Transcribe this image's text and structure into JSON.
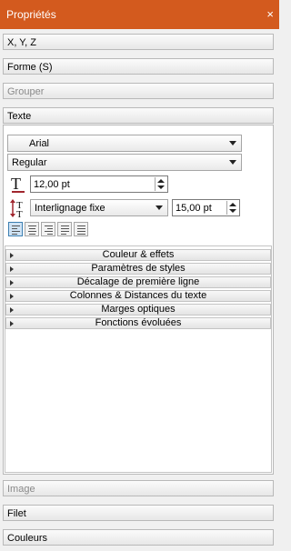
{
  "window": {
    "title": "Propriétés",
    "close_glyph": "×"
  },
  "sections_top": [
    {
      "label": "X, Y, Z",
      "disabled": false
    },
    {
      "label": "Forme (S)",
      "disabled": false
    },
    {
      "label": "Grouper",
      "disabled": true
    },
    {
      "label": "Texte",
      "disabled": false
    }
  ],
  "texte": {
    "font_family": "Arial",
    "font_style": "Regular",
    "font_size": "12,00 pt",
    "line_spacing_mode": "Interlignage fixe",
    "line_spacing_value": "15,00 pt",
    "alignment_active": "left",
    "subsections": [
      "Couleur & effets",
      "Paramètres de styles",
      "Décalage de première ligne",
      "Colonnes & Distances du texte",
      "Marges optiques",
      "Fonctions évoluées"
    ]
  },
  "sections_bottom": [
    {
      "label": "Image",
      "disabled": true
    },
    {
      "label": "Filet",
      "disabled": false
    },
    {
      "label": "Couleurs",
      "disabled": false
    }
  ]
}
